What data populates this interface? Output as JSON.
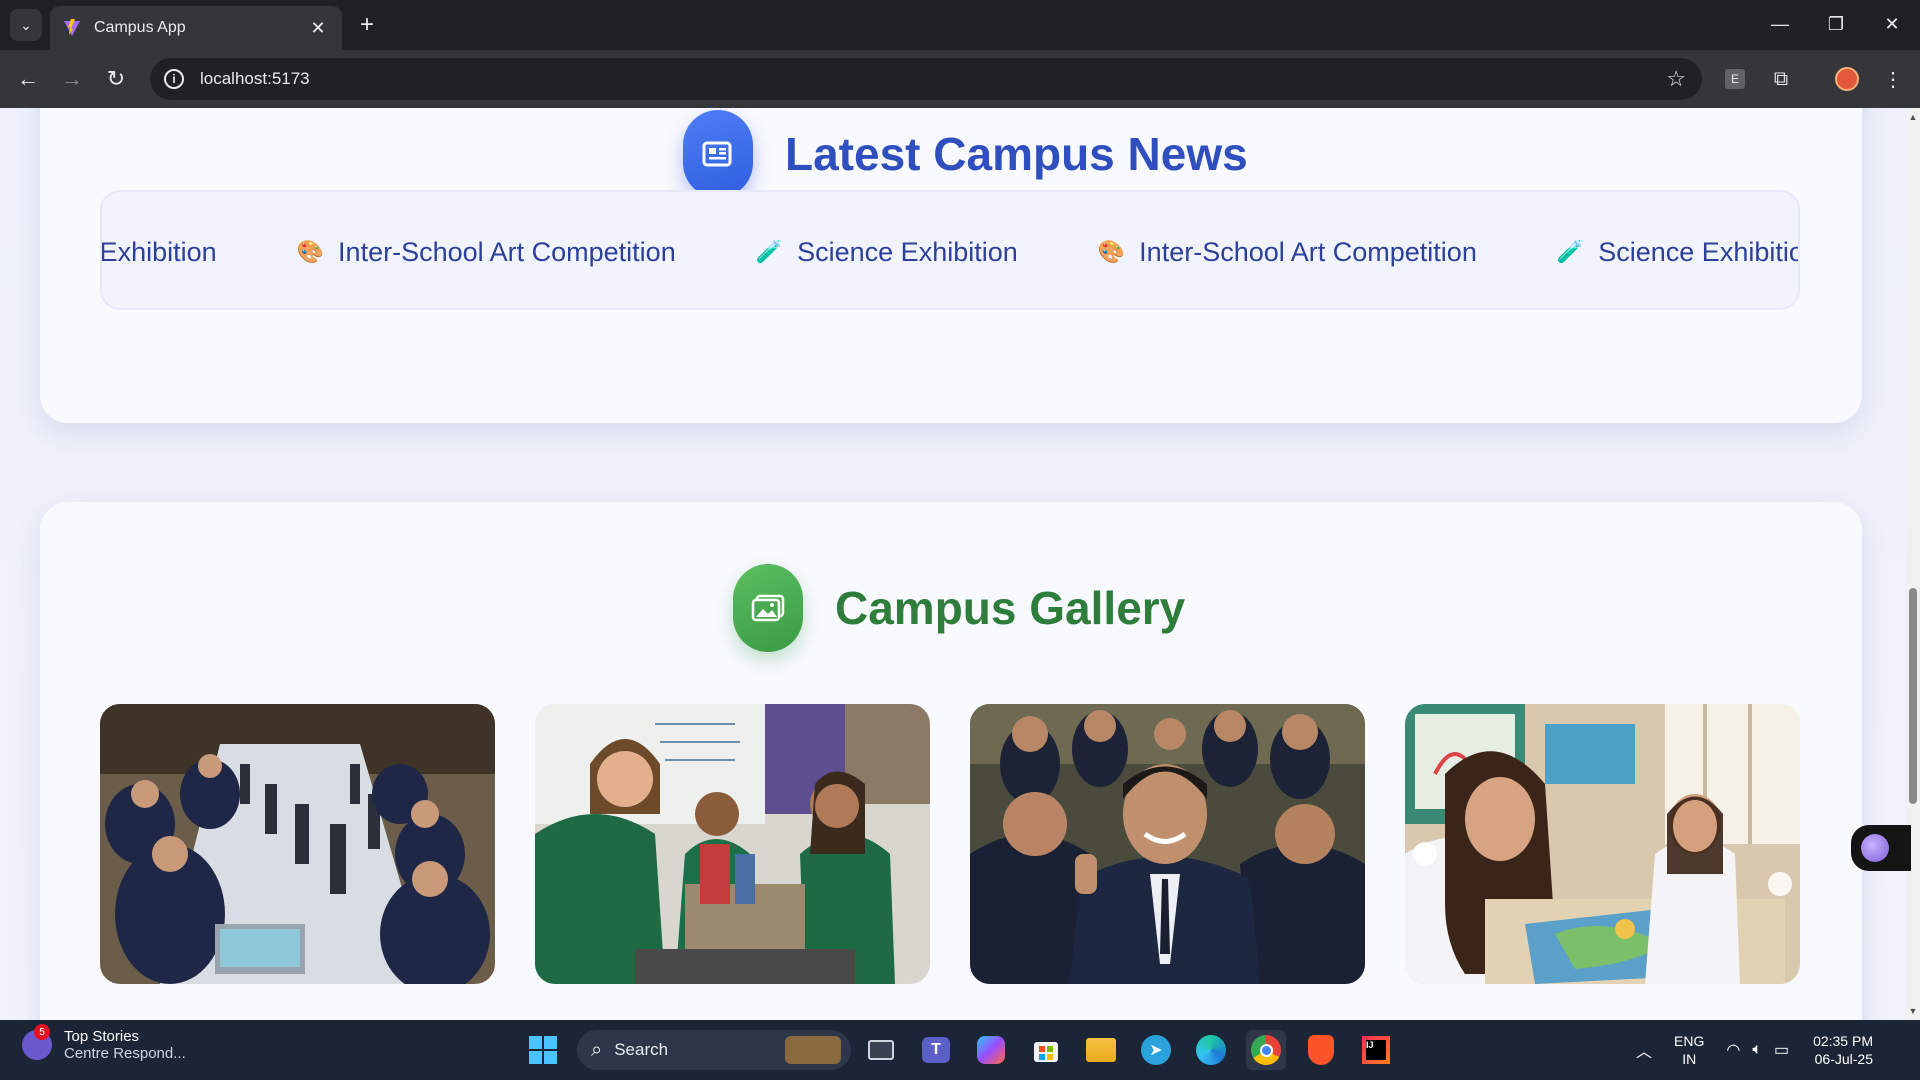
{
  "browser": {
    "tab_title": "Campus App",
    "url": "localhost:5173"
  },
  "news": {
    "title": "Latest Campus News",
    "items": [
      {
        "emoji": "",
        "label": "Science Exhibition"
      },
      {
        "emoji": "🎨",
        "label": "Inter-School Art Competition"
      },
      {
        "emoji": "🧪",
        "label": "Science Exhibition"
      },
      {
        "emoji": "🎨",
        "label": "Inter-School Art Competition"
      },
      {
        "emoji": "🧪",
        "label": "Science Exhibition"
      }
    ]
  },
  "gallery": {
    "title": "Campus Gallery"
  },
  "taskbar": {
    "news_title": "Top Stories",
    "news_subtitle": "Centre Respond...",
    "news_badge": "5",
    "search_label": "Search",
    "lang_top": "ENG",
    "lang_bottom": "IN",
    "time": "02:35 PM",
    "date": "06-Jul-25"
  }
}
